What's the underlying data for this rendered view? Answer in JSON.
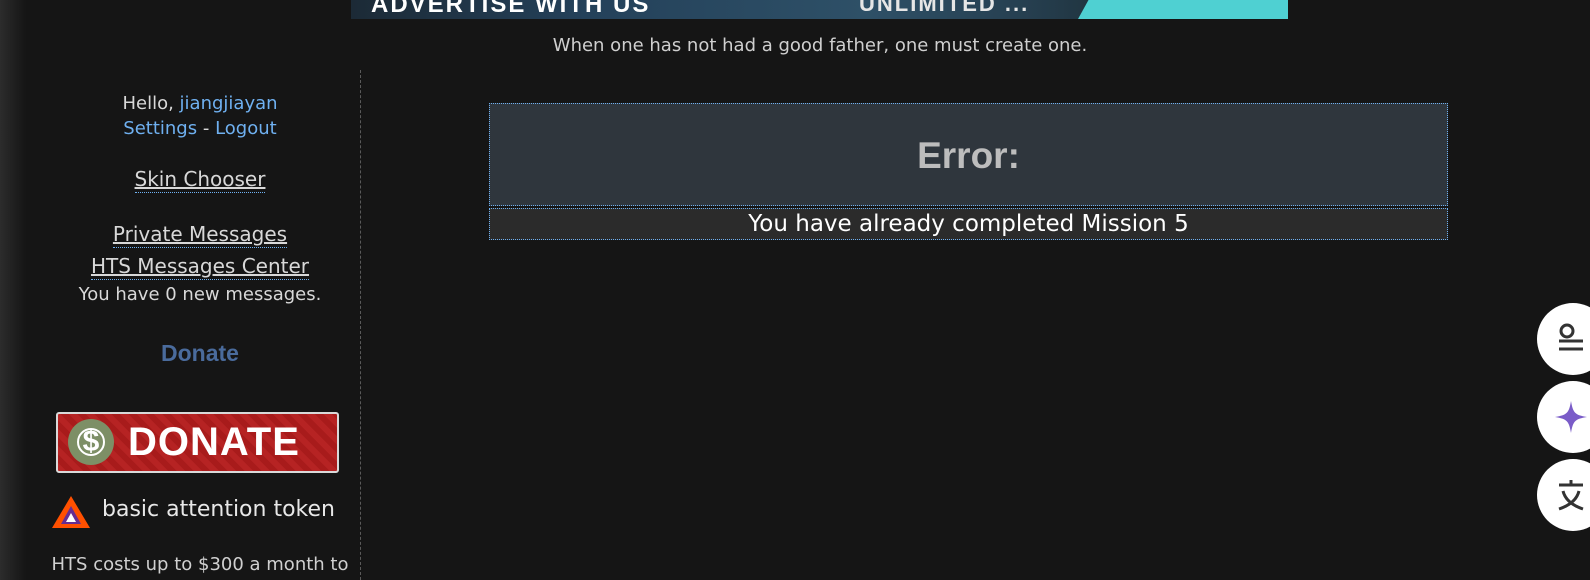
{
  "banner": {
    "left_text": "ADVERTISE WITH US",
    "mid_text": "UNLIMITED ..."
  },
  "quote": "When one has not had a good father, one must create one.",
  "sidebar": {
    "greeting": "Hello,",
    "username": "jiangjiayan",
    "settings": "Settings",
    "separator": "-",
    "logout": "Logout",
    "skin_chooser": "Skin Chooser",
    "private_messages": "Private Messages",
    "messages_center": "HTS Messages Center",
    "new_messages": "You have 0 new messages.",
    "donate_label": "Donate",
    "donate_button_text": "DONATE",
    "coin_symbol": "$",
    "bat_text": "basic attention token",
    "costs_text": "HTS costs up to $300 a month to"
  },
  "error": {
    "title": "Error:",
    "message": "You have already completed Mission 5"
  },
  "colors": {
    "background": "#151515",
    "link": "#6fb0f0",
    "donate_label": "#4a6b9c",
    "donate_button": "#b01e1e",
    "error_header": "#2f363d"
  },
  "floating_buttons": [
    {
      "icon": "menu-icon"
    },
    {
      "icon": "sparkle-icon"
    },
    {
      "icon": "translate-icon"
    }
  ]
}
